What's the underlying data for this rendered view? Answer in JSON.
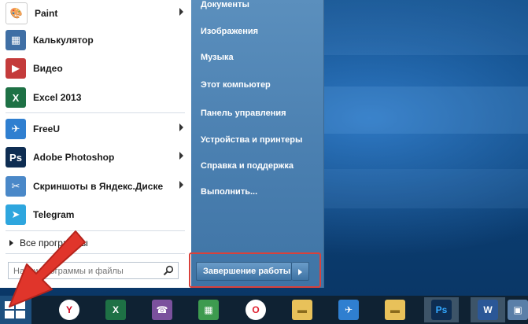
{
  "programs": [
    {
      "label": "Paint",
      "icon": "paint-icon",
      "color": "#ffffff",
      "glyph": "🎨",
      "has_submenu": true
    },
    {
      "label": "Калькулятор",
      "icon": "calculator-icon",
      "color": "#3f6fa5",
      "glyph": "▦",
      "has_submenu": false
    },
    {
      "label": "Видео",
      "icon": "video-icon",
      "color": "#c43b3b",
      "glyph": "▶",
      "has_submenu": false
    },
    {
      "label": "Excel 2013",
      "icon": "excel-icon",
      "color": "#1e7145",
      "glyph": "X",
      "has_submenu": false
    },
    {
      "label": "FreeU",
      "icon": "freeu-icon",
      "color": "#2f7fd0",
      "glyph": "✈",
      "has_submenu": true
    },
    {
      "label": "Adobe Photoshop",
      "icon": "photoshop-icon",
      "color": "#0e2d52",
      "glyph": "Ps",
      "has_submenu": true
    },
    {
      "label": "Скриншоты в Яндекс.Диске",
      "icon": "yandex-screenshot-icon",
      "color": "#4a88c8",
      "glyph": "✂",
      "has_submenu": true
    },
    {
      "label": "Telegram",
      "icon": "telegram-icon",
      "color": "#2ea6de",
      "glyph": "➤",
      "has_submenu": false
    }
  ],
  "all_programs_label": "Все программы",
  "search": {
    "placeholder": "Найти программы и файлы"
  },
  "right_links": [
    "Документы",
    "Изображения",
    "Музыка",
    "Этот компьютер",
    "Панель управления",
    "Устройства и принтеры",
    "Справка и поддержка",
    "Выполнить..."
  ],
  "shutdown_label": "Завершение работы",
  "taskbar": [
    {
      "name": "yandex-browser-icon",
      "glyph": "Y",
      "color": "#ffffff",
      "fg": "#d0021b"
    },
    {
      "name": "excel-taskbar-icon",
      "glyph": "X",
      "color": "#1e7145",
      "fg": "#ffffff"
    },
    {
      "name": "viber-icon",
      "glyph": "☎",
      "color": "#7b519d",
      "fg": "#ffffff"
    },
    {
      "name": "excel-workbook-icon",
      "glyph": "▦",
      "color": "#3d9b4f",
      "fg": "#ffffff"
    },
    {
      "name": "opera-icon",
      "glyph": "O",
      "color": "#ffffff",
      "fg": "#e01e2e"
    },
    {
      "name": "file-explorer-icon",
      "glyph": "▬",
      "color": "#e8c15a",
      "fg": "#8a6a1c"
    },
    {
      "name": "freeu-taskbar-icon",
      "glyph": "✈",
      "color": "#2f7fd0",
      "fg": "#ffffff"
    },
    {
      "name": "file-explorer-2-icon",
      "glyph": "▬",
      "color": "#e8c15a",
      "fg": "#8a6a1c"
    },
    {
      "name": "photoshop-taskbar-icon",
      "glyph": "Ps",
      "color": "#0e2d52",
      "fg": "#33a8ff"
    },
    {
      "name": "word-icon",
      "glyph": "W",
      "color": "#2b5797",
      "fg": "#ffffff"
    },
    {
      "name": "image-viewer-icon",
      "glyph": "▣",
      "color": "#5a7fa8",
      "fg": "#ffffff"
    }
  ]
}
